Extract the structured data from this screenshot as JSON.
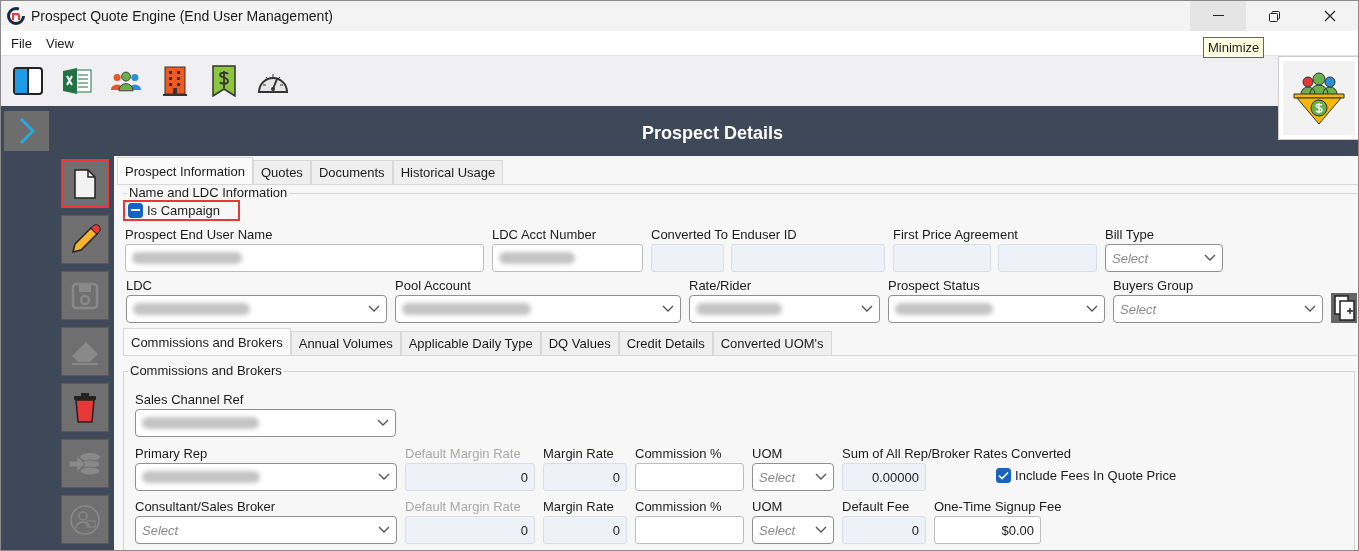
{
  "window": {
    "title": "Prospect Quote Engine (End User Management)",
    "tooltip": "Minimize"
  },
  "menu": [
    {
      "label": "File"
    },
    {
      "label": "View"
    }
  ],
  "toolbar": [
    {
      "kind": "panel"
    },
    {
      "kind": "excel"
    },
    {
      "kind": "people"
    },
    {
      "kind": "building"
    },
    {
      "kind": "dollar"
    },
    {
      "kind": "gauge"
    }
  ],
  "header": {
    "title": "Prospect Details"
  },
  "side_tools": [
    {
      "kind": "document",
      "highlighted": true,
      "disabled": false
    },
    {
      "kind": "pencil",
      "highlighted": false,
      "disabled": false
    },
    {
      "kind": "save",
      "highlighted": false,
      "disabled": true
    },
    {
      "kind": "eraser",
      "highlighted": false,
      "disabled": true
    },
    {
      "kind": "trash",
      "highlighted": false,
      "disabled": false
    },
    {
      "kind": "coins",
      "highlighted": false,
      "disabled": true
    },
    {
      "kind": "user",
      "highlighted": false,
      "disabled": true
    }
  ],
  "tabs": [
    {
      "label": "Prospect Information",
      "selected": true
    },
    {
      "label": "Quotes",
      "selected": false
    },
    {
      "label": "Documents",
      "selected": false
    },
    {
      "label": "Historical Usage",
      "selected": false
    }
  ],
  "name_section": {
    "title": "Name and LDC Information",
    "campaign": {
      "label": "Is Campaign",
      "indeterminate": true,
      "highlighted": true
    },
    "rows": [
      [
        {
          "label": "Prospect End User Name",
          "kind": "text",
          "redacted": true
        },
        {
          "label": "LDC Acct Number",
          "kind": "text",
          "redacted": true
        },
        {
          "label": "Converted To Enduser ID",
          "kind": "readonly_pair"
        },
        {
          "label": "First Price Agreement",
          "kind": "readonly_pair"
        },
        {
          "label": "Bill Type",
          "kind": "select",
          "placeholder": "Select"
        }
      ],
      [
        {
          "label": "LDC",
          "kind": "select",
          "redacted": true
        },
        {
          "label": "Pool Account",
          "kind": "select",
          "redacted": true
        },
        {
          "label": "Rate/Rider",
          "kind": "select",
          "redacted": true
        },
        {
          "label": "Prospect Status",
          "kind": "select",
          "redacted": true
        },
        {
          "label": "Buyers Group",
          "kind": "select",
          "placeholder": "Select"
        }
      ]
    ]
  },
  "sub_tabs": [
    {
      "label": "Commissions and Brokers",
      "selected": true
    },
    {
      "label": "Annual Volumes",
      "selected": false
    },
    {
      "label": "Applicable Daily Type",
      "selected": false
    },
    {
      "label": "DQ Values",
      "selected": false
    },
    {
      "label": "Credit Details",
      "selected": false
    },
    {
      "label": "Converted UOM's",
      "selected": false
    }
  ],
  "commissions": {
    "title": "Commissions and Brokers",
    "sales_channel": {
      "label": "Sales Channel Ref",
      "kind": "select",
      "redacted": true
    },
    "rows": [
      [
        {
          "label": "Primary Rep",
          "kind": "select",
          "redacted": true
        },
        {
          "label": "Default Margin Rate",
          "kind": "readonly",
          "value": "0",
          "disabled": true
        },
        {
          "label": "Margin Rate",
          "kind": "readonly",
          "value": "0",
          "disabled": false
        },
        {
          "label": "Commission %",
          "kind": "text"
        },
        {
          "label": "UOM",
          "kind": "select",
          "placeholder": "Select"
        },
        {
          "label": "Sum of All Rep/Broker Rates Converted",
          "kind": "readonly",
          "value": "0.00000",
          "disabled": false
        }
      ],
      [
        {
          "label": "Consultant/Sales Broker",
          "kind": "select",
          "placeholder": "Select"
        },
        {
          "label": "Default Margin Rate",
          "kind": "readonly",
          "value": "0",
          "disabled": true
        },
        {
          "label": "Margin Rate",
          "kind": "readonly",
          "value": "0",
          "disabled": false
        },
        {
          "label": "Commission %",
          "kind": "text"
        },
        {
          "label": "UOM",
          "kind": "select",
          "placeholder": "Select"
        },
        {
          "label": "Default Fee",
          "kind": "readonly",
          "value": "0",
          "disabled": false
        },
        {
          "label": "One-Time Signup Fee",
          "kind": "text",
          "value": "$0.00"
        }
      ]
    ],
    "include_fees": {
      "label": "Include Fees In Quote Price",
      "checked": true
    }
  }
}
